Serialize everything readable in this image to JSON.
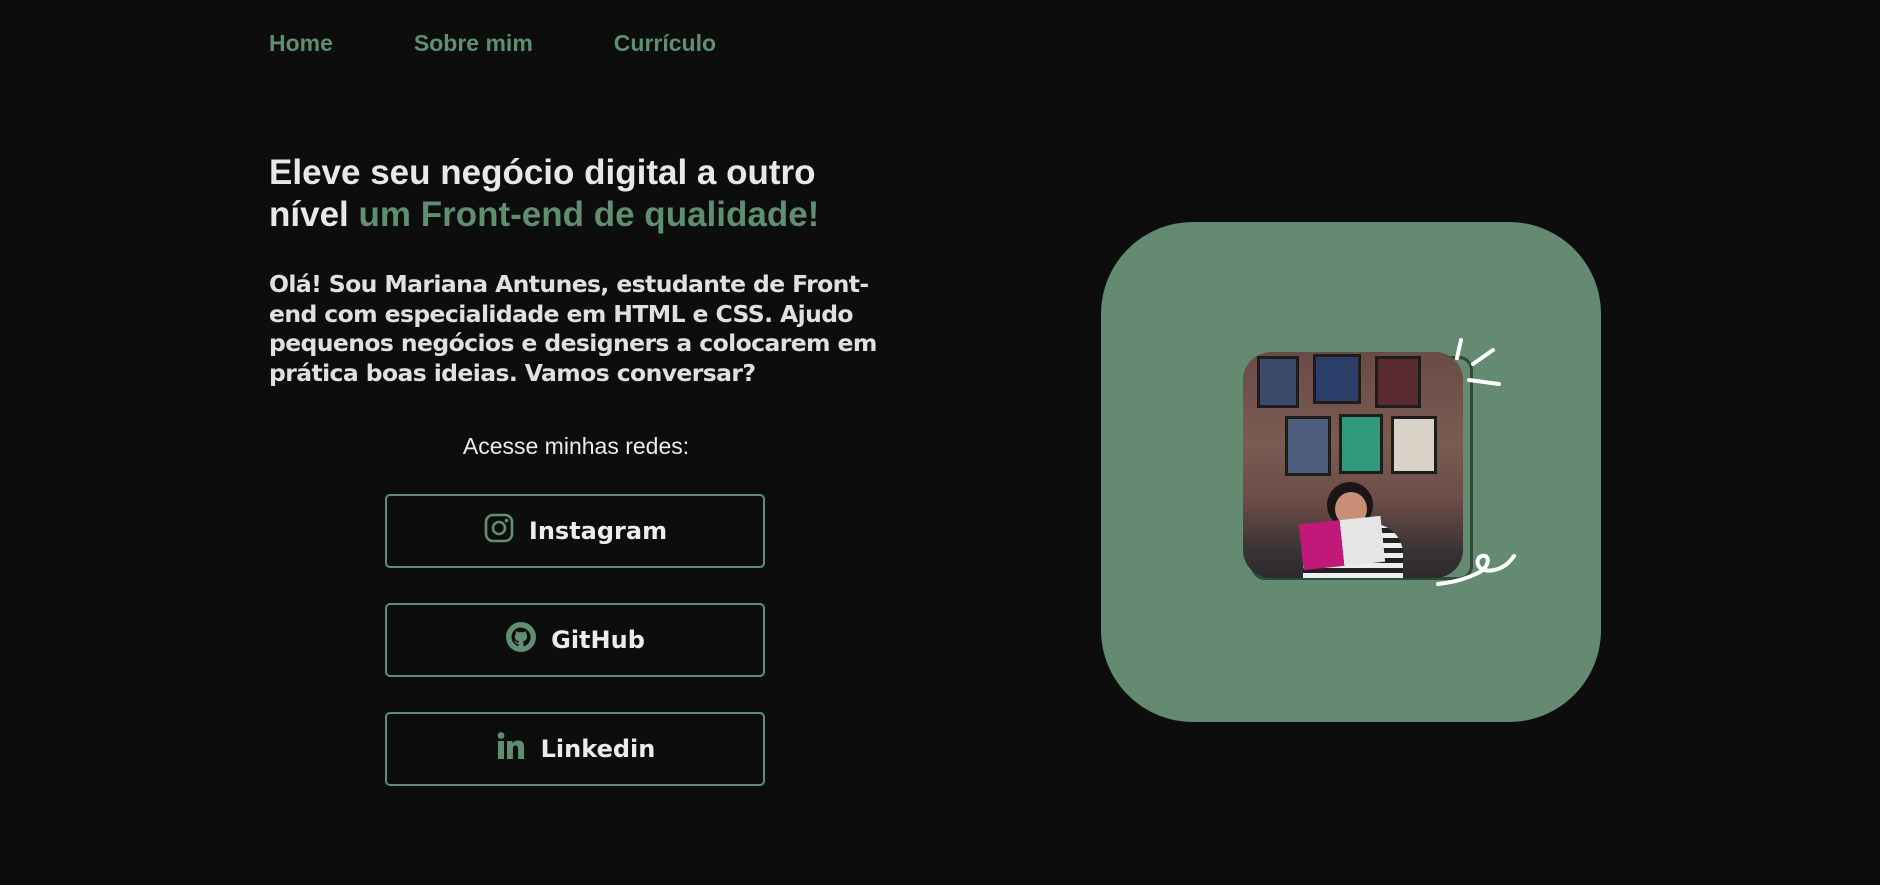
{
  "nav": {
    "items": [
      {
        "label": "Home"
      },
      {
        "label": "Sobre mim"
      },
      {
        "label": "Currículo"
      }
    ]
  },
  "hero": {
    "title_main": "Eleve seu negócio digital a outro nível",
    "title_accent": "um Front-end de qualidade!",
    "intro": "Olá! Sou Mariana Antunes, estudante de Front-end com especialidade em HTML e CSS. Ajudo pequenos negócios e designers a colocarem em prática boas ideias. Vamos conversar?"
  },
  "social": {
    "label": "Acesse minhas redes:",
    "links": [
      {
        "label": "Instagram",
        "icon": "instagram-icon"
      },
      {
        "label": "GitHub",
        "icon": "github-icon"
      },
      {
        "label": "Linkedin",
        "icon": "linkedin-icon"
      }
    ]
  },
  "colors": {
    "background": "#0d0d0d",
    "accent": "#5f8f70",
    "card": "#658a72",
    "text": "#e6e6e6"
  }
}
